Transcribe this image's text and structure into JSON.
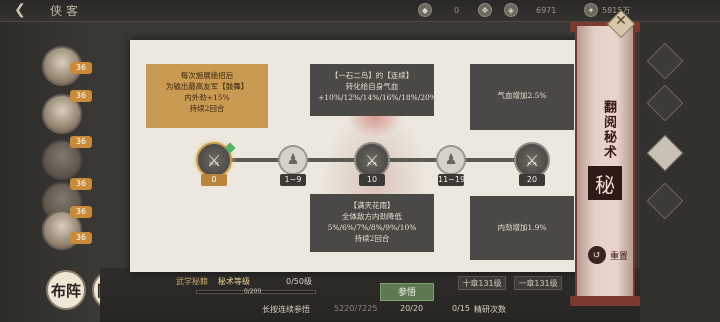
{
  "header": {
    "back_glyph": "❮",
    "title": "侠客",
    "resources": [
      {
        "icon": "◆",
        "value": "0"
      },
      {
        "icon": "❖",
        "value": ""
      },
      {
        "icon": "◈",
        "value": "6971"
      },
      {
        "icon": "✦",
        "value": "5815万"
      }
    ]
  },
  "heroes": {
    "levels": [
      "36",
      "36",
      "36",
      "36",
      "36",
      "36"
    ]
  },
  "left_buttons": {
    "left": "布阵",
    "right": "同门"
  },
  "panel": {
    "cards": {
      "gold": [
        "每次施展绝招后",
        "为输出最高友军【鼓舞】",
        "内外劲+15%",
        "持续2回合"
      ],
      "top_mid": [
        "【一石二鸟】的【连续】",
        "转化给自身气血",
        "+10%/12%/14%/16%/18%/20%"
      ],
      "top_right": [
        "气血增加2.5%"
      ],
      "bottom_mid": [
        "【满天花雨】",
        "全体敌方内劲降低",
        "5%/6%/7%/8%/9%/10%",
        "持续2回合"
      ],
      "bottom_right": [
        "内劲增加1.9%"
      ]
    },
    "nodes": [
      {
        "label": "0",
        "type": "sword"
      },
      {
        "label": "1~9",
        "type": "meditate"
      },
      {
        "label": "10",
        "type": "sword"
      },
      {
        "label": "11~19",
        "type": "meditate"
      },
      {
        "label": "20",
        "type": "sword"
      }
    ]
  },
  "scroll": {
    "title": "翻阅秘术",
    "seal": "秘",
    "reset_label": "重置",
    "close_glyph": "✕"
  },
  "bottom": {
    "category": "武学秘籍",
    "skill_label": "秘术等级",
    "level": "0/50级",
    "progress": "0/200",
    "progress_fraction": 0.0,
    "study_button": "参悟",
    "hint": "长按连续参悟",
    "exp": "5220/7225",
    "count": "20/20",
    "sessions": "0/15",
    "sessions_label": "精研次数",
    "ten_button": "十章131级",
    "one_button": "一章131级"
  }
}
